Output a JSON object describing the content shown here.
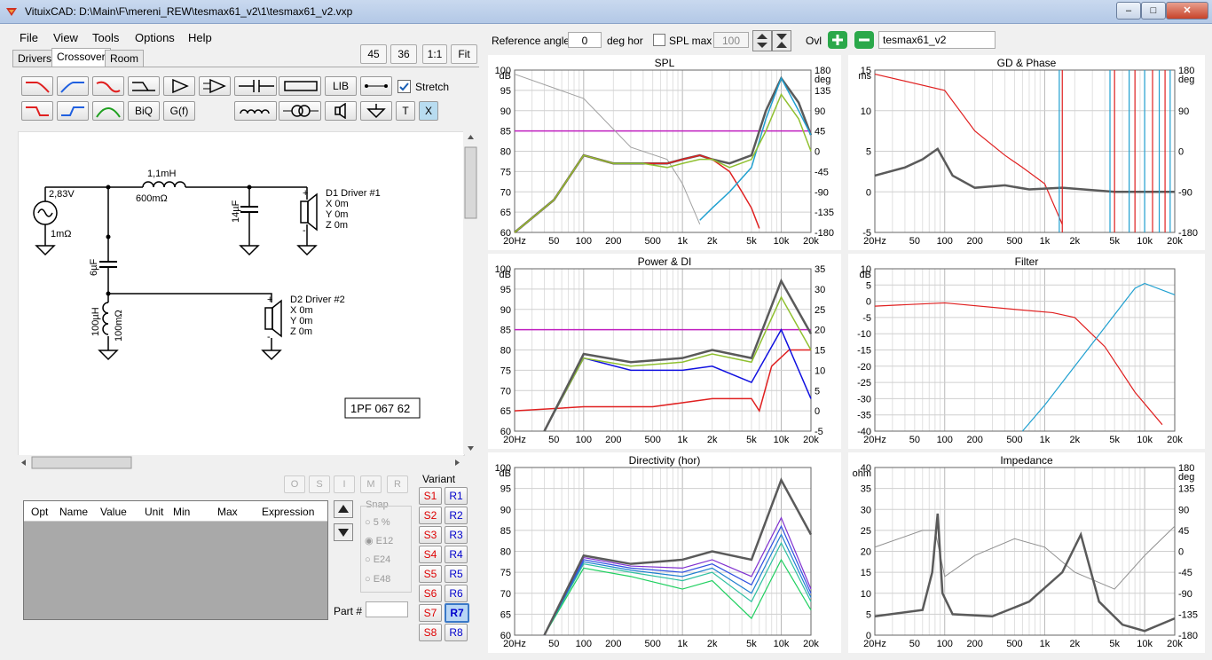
{
  "window": {
    "title": "VituixCAD: D:\\Main\\F\\mereni_REW\\tesmax61_v2\\1\\tesmax61_v2.vxp",
    "min_label": "–",
    "max_label": "□",
    "close_label": "✕"
  },
  "menu": [
    "File",
    "View",
    "Tools",
    "Options",
    "Help"
  ],
  "zoom_buttons": [
    "45",
    "36",
    "1:1",
    "Fit"
  ],
  "tabs": [
    "Drivers",
    "Crossover",
    "Room"
  ],
  "toolbar": {
    "lib_label": "LIB",
    "biq_label": "BiQ",
    "gf_label": "G(f)",
    "t_label": "T",
    "x_label": "X",
    "stretch_label": "Stretch",
    "stretch_checked": true
  },
  "schematic": {
    "source_voltage": "2,83V",
    "source_resistance": "1mΩ",
    "series_inductor": "1,1mH",
    "series_inductor_resistance": "600mΩ",
    "shunt_cap1": "14µF",
    "shunt_cap2": "6µF",
    "shunt_inductor": "100µH",
    "shunt_inductor_resistance": "100mΩ",
    "d1_name": "D1 Driver #1",
    "d2_name": "D2 Driver #2",
    "d_x": "X 0m",
    "d_y": "Y 0m",
    "d_z": "Z 0m",
    "part_label": "1PF 067 62",
    "plus": "+",
    "minus": "-"
  },
  "opt_buttons": [
    "O",
    "S",
    "I",
    "M",
    "R"
  ],
  "param_table": {
    "headers": [
      "Opt",
      "Name",
      "Value",
      "Unit",
      "Min",
      "Max",
      "Expression"
    ]
  },
  "snap": {
    "label": "Snap",
    "options": [
      "5 %",
      "E12",
      "E24",
      "E48"
    ],
    "selected": "E12"
  },
  "part_number_label": "Part #",
  "variant": {
    "label": "Variant",
    "s_buttons": [
      "S1",
      "S2",
      "S3",
      "S4",
      "S5",
      "S6",
      "S7",
      "S8"
    ],
    "r_buttons": [
      "R1",
      "R2",
      "R3",
      "R4",
      "R5",
      "R6",
      "R7",
      "R8"
    ],
    "selected": "R7"
  },
  "top_controls": {
    "reference_angle_label": "Reference angle",
    "reference_angle_value": "0",
    "deg_hor_label": "deg hor",
    "spl_max_label": "SPL max",
    "spl_max_value": "100",
    "ovl_label": "Ovl",
    "overlay_name": "tesmax61_v2"
  },
  "graph_titles": [
    "SPL",
    "GD & Phase",
    "Power & DI",
    "Filter",
    "Directivity (hor)",
    "Impedance"
  ],
  "freq_ticks": [
    "20Hz",
    "50",
    "100",
    "200",
    "500",
    "1k",
    "2k",
    "5k",
    "10k",
    "20k"
  ],
  "colors": {
    "total": "#5a5a5a",
    "red": "#e02020",
    "blue": "#20a0d0",
    "green": "#90c030",
    "magenta": "#c020c0",
    "di_blue": "#1010e0"
  },
  "chart_data": [
    {
      "type": "line",
      "title": "SPL",
      "x_scale": "log",
      "xlim": [
        20,
        20000
      ],
      "ylabel": "dB",
      "ylim": [
        60,
        100
      ],
      "y2label": "deg",
      "y2lim": [
        -180,
        180
      ],
      "yticks": [
        100,
        95,
        90,
        85,
        80,
        75,
        70,
        65,
        60
      ],
      "y2ticks": [
        180,
        135,
        90,
        45,
        0,
        -45,
        -90,
        -135,
        -180
      ],
      "series": [
        {
          "x": [
            20,
            50,
            100,
            200,
            400,
            700,
            1000,
            1500,
            2000,
            3000,
            5000,
            7000,
            10000,
            15000,
            20000
          ],
          "y": [
            55,
            68,
            79,
            77,
            77,
            77,
            78,
            79,
            78,
            77,
            79,
            90,
            98,
            92,
            84
          ]
        },
        {
          "x": [
            20,
            50,
            100,
            200,
            400,
            700,
            1000,
            1500,
            2000,
            3000,
            4000,
            5000,
            6000
          ],
          "y": [
            55,
            68,
            79,
            77,
            77,
            77,
            78,
            79,
            78,
            75,
            70,
            66,
            61
          ]
        },
        {
          "x": [
            1500,
            2000,
            3000,
            5000,
            7000,
            10000,
            15000,
            20000
          ],
          "y": [
            63,
            66,
            70,
            76,
            88,
            98,
            90,
            84
          ]
        },
        {
          "x": [
            20,
            50,
            100,
            200,
            400,
            700,
            1000,
            1500,
            2000,
            3000,
            5000,
            7000,
            10000,
            15000,
            20000
          ],
          "y": [
            55,
            68,
            79,
            77,
            77,
            76,
            77,
            78,
            78,
            76,
            78,
            85,
            94,
            88,
            80
          ]
        }
      ]
    },
    {
      "type": "line",
      "title": "GD & Phase",
      "x_scale": "log",
      "xlim": [
        20,
        20000
      ],
      "ylabel": "ms",
      "ylim": [
        -5,
        15
      ],
      "y2label": "deg",
      "y2lim": [
        -180,
        180
      ],
      "yticks": [
        15,
        10,
        5,
        0,
        -5
      ],
      "y2ticks": [
        180,
        90,
        0,
        -90,
        -180
      ]
    },
    {
      "type": "line",
      "title": "Power & DI",
      "x_scale": "log",
      "xlim": [
        20,
        20000
      ],
      "ylabel": "dB",
      "ylim": [
        60,
        100
      ],
      "y2lim": [
        -5,
        35
      ],
      "yticks": [
        100,
        95,
        90,
        85,
        80,
        75,
        70,
        65,
        60
      ],
      "y2ticks": [
        35,
        30,
        25,
        20,
        15,
        10,
        5,
        0,
        -5
      ]
    },
    {
      "type": "line",
      "title": "Filter",
      "x_scale": "log",
      "xlim": [
        20,
        20000
      ],
      "ylabel": "dB",
      "ylim": [
        -40,
        10
      ],
      "yticks": [
        10,
        5,
        0,
        -5,
        -10,
        -15,
        -20,
        -25,
        -30,
        -35,
        -40
      ]
    },
    {
      "type": "line",
      "title": "Directivity (hor)",
      "x_scale": "log",
      "xlim": [
        20,
        20000
      ],
      "ylabel": "dB",
      "ylim": [
        60,
        100
      ],
      "yticks": [
        100,
        95,
        90,
        85,
        80,
        75,
        70,
        65,
        60
      ]
    },
    {
      "type": "line",
      "title": "Impedance",
      "x_scale": "log",
      "xlim": [
        20,
        20000
      ],
      "ylabel": "ohm",
      "ylim": [
        0,
        40
      ],
      "y2label": "deg",
      "y2lim": [
        -180,
        180
      ],
      "yticks": [
        40,
        35,
        30,
        25,
        20,
        15,
        10,
        5,
        0
      ],
      "y2ticks": [
        180,
        135,
        90,
        45,
        0,
        -45,
        -90,
        -135,
        -180
      ]
    }
  ]
}
